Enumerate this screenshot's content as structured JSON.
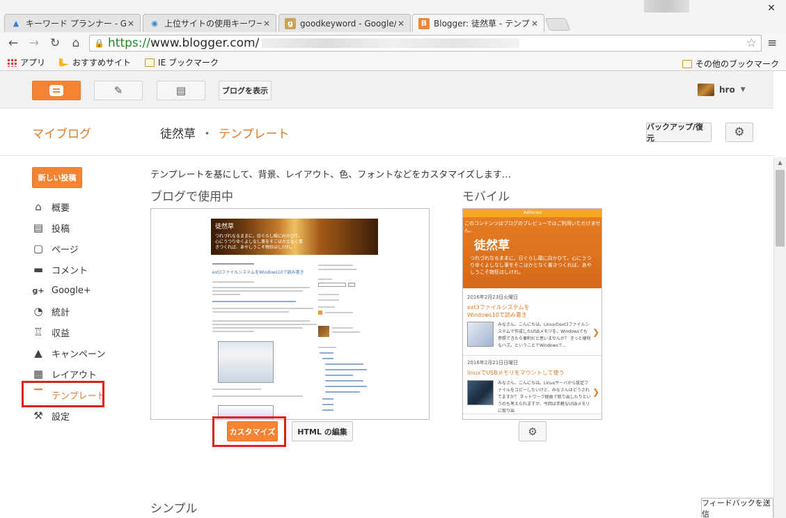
{
  "browser": {
    "tabs": [
      {
        "title": "キーワード プランナー - Google",
        "favicon": "google-ads-icon",
        "active": false
      },
      {
        "title": "上位サイトの使用キーワード（",
        "favicon": "globe-icon",
        "active": false
      },
      {
        "title": "goodkeyword - Google/Bi",
        "favicon": "goodkeyword-icon",
        "active": false
      },
      {
        "title": "Blogger: 徒然草 - テンプレ",
        "favicon": "blogger-icon",
        "active": true
      }
    ],
    "url_scheme": "https://",
    "url_host": "www.blogger.com/",
    "bookmarks": [
      {
        "label": "アプリ",
        "icon": "apps-icon"
      },
      {
        "label": "おすすめサイト",
        "icon": "bing-icon"
      },
      {
        "label": "IE ブックマーク",
        "icon": "folder-icon"
      }
    ],
    "bookmarks_other": "その他のブックマーク"
  },
  "topbar": {
    "view_blog": "ブログを表示",
    "user_name": "hro"
  },
  "header": {
    "my_blog": "マイブログ",
    "blog_name": "徒然草",
    "separator": "・",
    "section": "テンプレート",
    "backup_restore": "バックアップ/復元"
  },
  "sidebar": {
    "new_post": "新しい投稿",
    "items": [
      {
        "label": "概要",
        "icon": "home-icon"
      },
      {
        "label": "投稿",
        "icon": "posts-icon"
      },
      {
        "label": "ページ",
        "icon": "pages-icon"
      },
      {
        "label": "コメント",
        "icon": "comment-icon"
      },
      {
        "label": "Google+",
        "icon": "google-plus-icon"
      },
      {
        "label": "統計",
        "icon": "stats-icon"
      },
      {
        "label": "収益",
        "icon": "trophy-icon"
      },
      {
        "label": "キャンペーン",
        "icon": "campaign-icon"
      },
      {
        "label": "レイアウト",
        "icon": "layout-icon"
      },
      {
        "label": "テンプレート",
        "icon": "template-icon",
        "active": true
      },
      {
        "label": "設定",
        "icon": "wrench-icon"
      }
    ]
  },
  "main": {
    "intro": "テンプレートを基にして、背景、レイアウト、色、フォントなどをカスタマイズします…",
    "in_use_title": "ブログで使用中",
    "mobile_title": "モバイル",
    "customize": "カスタマイズ",
    "edit_html": "HTML の編集",
    "simple_title": "シンプル",
    "preview": {
      "header_title": "徒然草",
      "header_subtitle": "つれづれなるままに、日ぐらし硯に向かひて、心にうつりゆくよしなし事をそこはかとなく書きつくれば、あやしうこそ物狂ほしけれ。",
      "post_title": "ext3ファイルシステムをWindows10で読み書き"
    },
    "mobile_preview": {
      "ad_label": "AdSense",
      "ad_note": "このコンテンツはブログのプレビューではご利用いただけません。",
      "title": "徒然草",
      "subtitle": "つれづれなるままに、日ぐらし硯に向かひて、心にうつりゆくよしなし事をそこはかとなく書きつくれば、あやしうこそ物狂ほしけれ。",
      "posts": [
        {
          "date": "2016年2月23日火曜日",
          "title": "ext3ファイルシステムをWindows10で読み書き",
          "excerpt": "みなさん、こんにちは。Linuxのext3ファイルシステムで作成したUSBメモリを、Windowsでも参照できたら便利だと思いませんか？ きっと便利なハズ。ということでWindowsで..."
        },
        {
          "date": "2016年2月21日日曜日",
          "title": "linuxでUSBメモリをマウントして使う",
          "excerpt": "みなさん、こんにちは。Linuxサーバから設定ファイルをコピーしたいけど、みなさんはどうされてますか？ ネットワーク経由で取り出したりというのも考えられますが、今回は手軽なUSBメモリに取り出"
        }
      ]
    }
  },
  "feedback": "フィードバックを送信"
}
